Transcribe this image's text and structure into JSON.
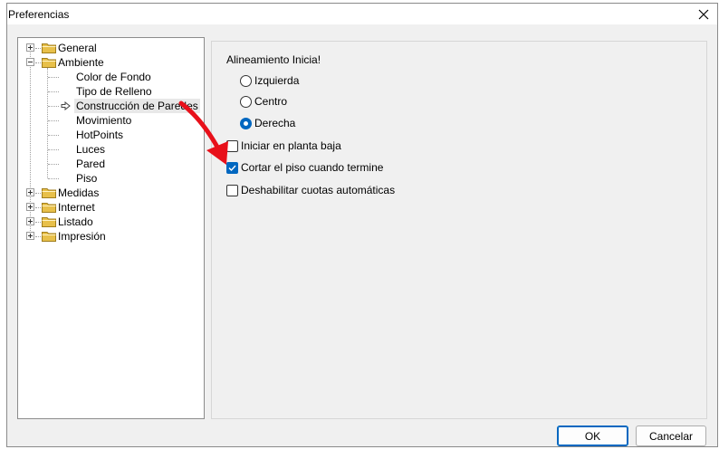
{
  "window": {
    "title": "Preferencias"
  },
  "tree": {
    "items": [
      {
        "label": "General",
        "level": 0,
        "expander": "+",
        "folder": true
      },
      {
        "label": "Ambiente",
        "level": 0,
        "expander": "-",
        "folder": true
      },
      {
        "label": "Color de Fondo",
        "level": 1
      },
      {
        "label": "Tipo de Relleno",
        "level": 1
      },
      {
        "label": "Construcción de Paredes",
        "level": 1,
        "selected": true
      },
      {
        "label": "Movimiento",
        "level": 1
      },
      {
        "label": "HotPoints",
        "level": 1
      },
      {
        "label": "Luces",
        "level": 1
      },
      {
        "label": "Pared",
        "level": 1
      },
      {
        "label": "Piso",
        "level": 1
      },
      {
        "label": "Medidas",
        "level": 0,
        "expander": "+",
        "folder": true
      },
      {
        "label": "Internet",
        "level": 0,
        "expander": "+",
        "folder": true
      },
      {
        "label": "Listado",
        "level": 0,
        "expander": "+",
        "folder": true
      },
      {
        "label": "Impresión",
        "level": 0,
        "expander": "+",
        "folder": true
      }
    ]
  },
  "options": {
    "group_title": "Alineamiento Inicia!",
    "radios": [
      {
        "label": "Izquierda",
        "checked": false
      },
      {
        "label": "Centro",
        "checked": false
      },
      {
        "label": "Derecha",
        "checked": true
      }
    ],
    "checkboxes": [
      {
        "label": "Iniciar en planta baja",
        "checked": false
      },
      {
        "label": "Cortar el piso cuando termine",
        "checked": true
      },
      {
        "label": "Deshabilitar cuotas automáticas",
        "checked": false
      }
    ]
  },
  "buttons": {
    "ok": "OK",
    "cancel": "Cancelar"
  },
  "colors": {
    "accent": "#0067c0",
    "annotation": "#e8101a",
    "folder": "#e8c04a"
  }
}
